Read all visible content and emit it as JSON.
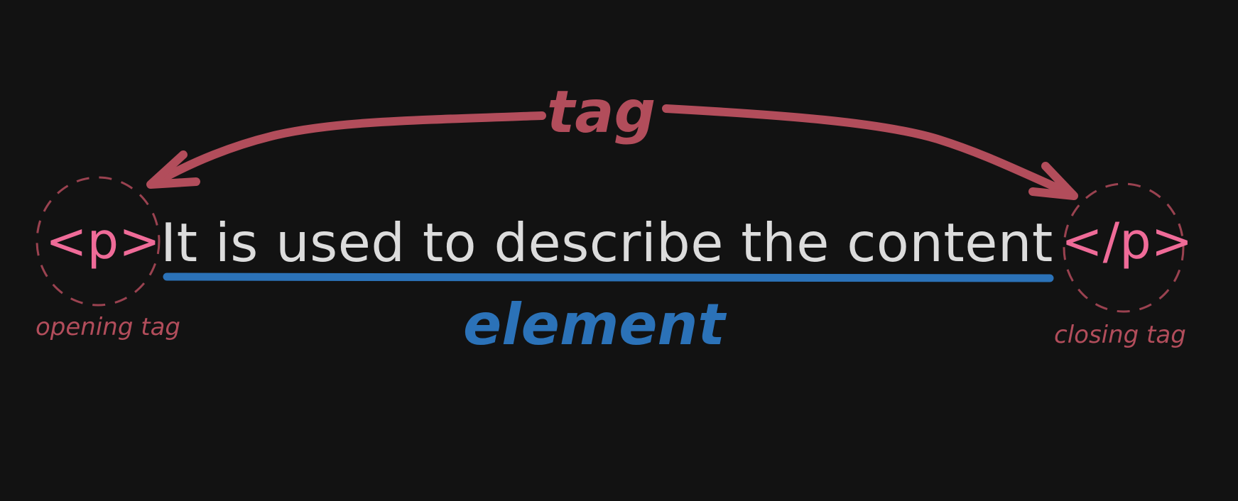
{
  "labels": {
    "tag": "tag",
    "opening_tag_code": "<p>",
    "closing_tag_code": "</p>",
    "content": "It is used to describe the content",
    "element": "element",
    "opening_caption": "opening tag",
    "closing_caption": "closing tag"
  },
  "colors": {
    "background": "#121212",
    "tag_accent": "#b24d5b",
    "code_pink": "#ef6b98",
    "content_text": "#dcdcdc",
    "element_blue": "#2b72b8"
  }
}
